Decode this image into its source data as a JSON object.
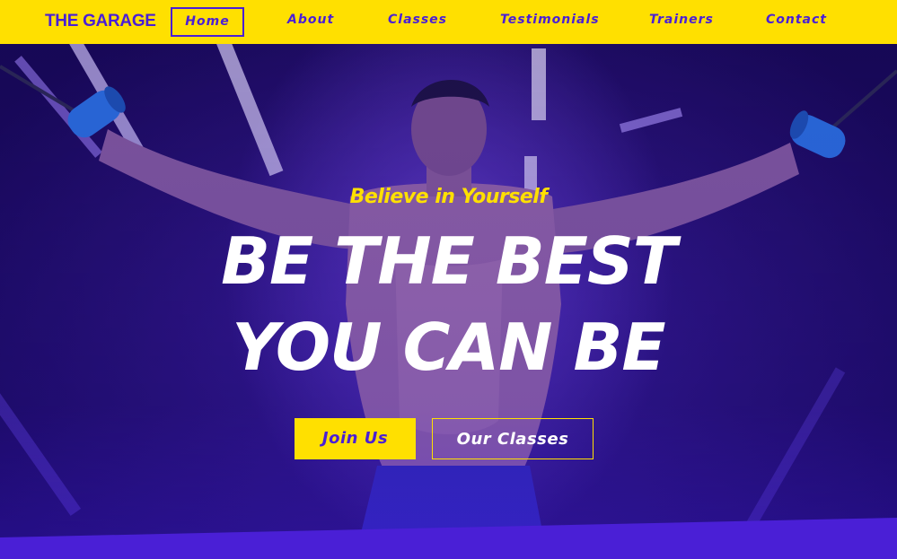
{
  "brand": {
    "name": "THE GARAGE"
  },
  "nav": {
    "items": [
      {
        "label": "Home"
      },
      {
        "label": "About"
      },
      {
        "label": "Classes"
      },
      {
        "label": "Testimonials"
      },
      {
        "label": "Trainers"
      },
      {
        "label": "Contact"
      }
    ],
    "active_label": "Home"
  },
  "hero": {
    "tagline": "Believe in Yourself",
    "headline_line1": "BE THE BEST",
    "headline_line2": "YOU CAN BE",
    "primary_button": "Join Us",
    "secondary_button": "Our Classes",
    "image_icon": "athlete-cable-crossover-photo"
  },
  "colors": {
    "accent_yellow": "#ffe000",
    "brand_purple": "#4a1fd6",
    "hero_overlay": "#2a118a",
    "headline_white": "#ffffff"
  }
}
